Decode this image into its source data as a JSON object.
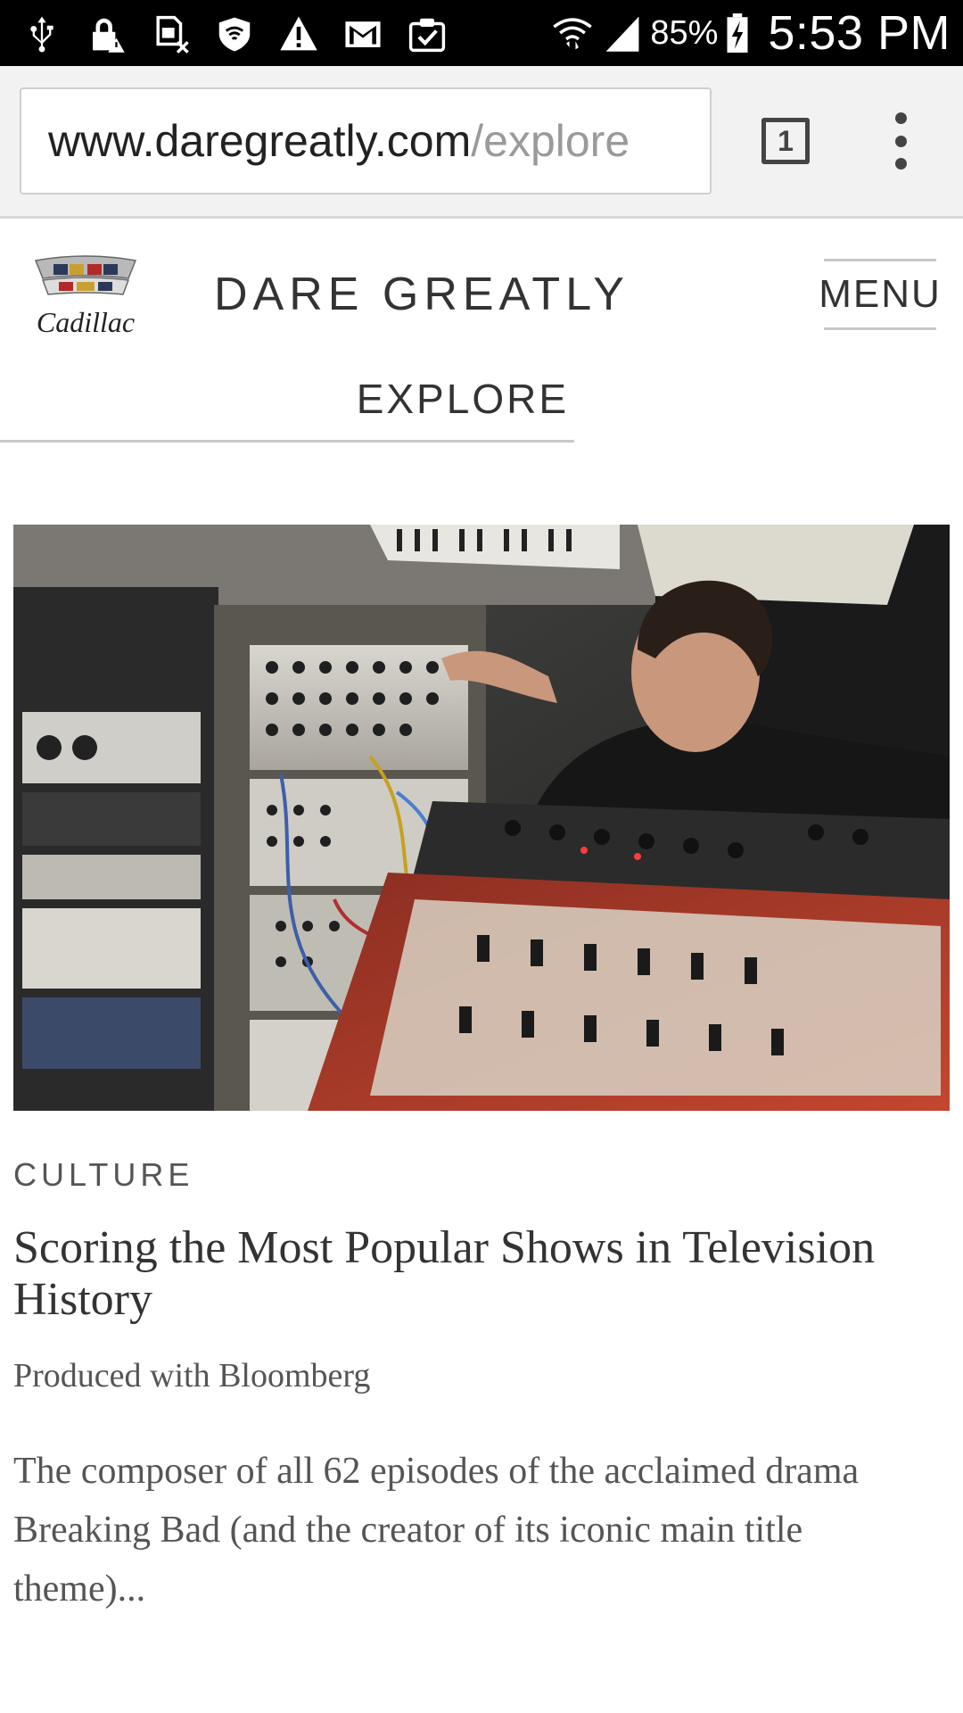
{
  "status_bar": {
    "icons": [
      "usb-icon",
      "lock-icon",
      "sim-icon",
      "shield-icon",
      "warning-icon",
      "gmail-icon",
      "clipboard-check-icon"
    ],
    "right_icons": [
      "wifi-icon",
      "signal-icon"
    ],
    "battery_percent": "85%",
    "battery_icon": "battery-charging-icon",
    "time": "5:53 PM"
  },
  "browser": {
    "url_domain": "www.daregreatly.com",
    "url_path": "/explore",
    "tab_count": "1",
    "menu_icon": "overflow-menu-icon"
  },
  "site": {
    "logo_text": "Cadillac",
    "title": "DARE GREATLY",
    "menu_label": "MENU",
    "section_label": "EXPLORE"
  },
  "article": {
    "category": "CULTURE",
    "headline": "Scoring the Most Popular Shows in Television History",
    "produced": "Produced with Bloomberg",
    "excerpt": "The composer of all 62 episodes of the acclaimed drama Breaking Bad (and the creator of its iconic main title theme)..."
  },
  "colors": {
    "status_bar_bg": "#000000",
    "toolbar_bg": "#f2f2f2",
    "url_path_color": "#9a9a9a",
    "text_dark": "#333333",
    "text_muted": "#555555"
  }
}
